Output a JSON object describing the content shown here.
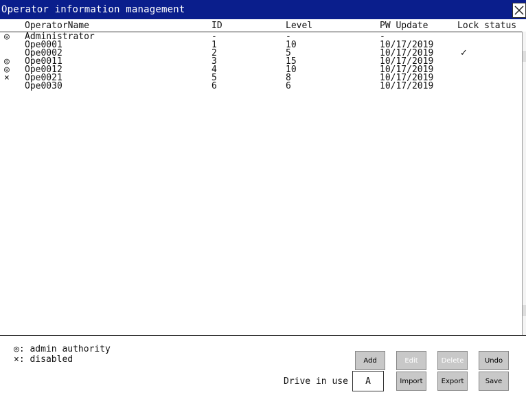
{
  "window": {
    "title": "Operator information management"
  },
  "columns": {
    "operator_name": "OperatorName",
    "id": "ID",
    "level": "Level",
    "pw_update": "PW Update",
    "lock_status": "Lock status"
  },
  "rows": [
    {
      "mark": "◎",
      "name": "Administrator",
      "id": "-",
      "level": "-",
      "pw_update": "-",
      "lock": ""
    },
    {
      "mark": "",
      "name": "Ope0001",
      "id": "1",
      "level": "10",
      "pw_update": "10/17/2019",
      "lock": ""
    },
    {
      "mark": "",
      "name": "Ope0002",
      "id": "2",
      "level": "5",
      "pw_update": "10/17/2019",
      "lock": "✓"
    },
    {
      "mark": "◎",
      "name": "Ope0011",
      "id": "3",
      "level": "15",
      "pw_update": "10/17/2019",
      "lock": ""
    },
    {
      "mark": "◎",
      "name": "Ope0012",
      "id": "4",
      "level": "10",
      "pw_update": "10/17/2019",
      "lock": ""
    },
    {
      "mark": "×",
      "name": "Ope0021",
      "id": "5",
      "level": "8",
      "pw_update": "10/17/2019",
      "lock": ""
    },
    {
      "mark": "",
      "name": "Ope0030",
      "id": "6",
      "level": "6",
      "pw_update": "10/17/2019",
      "lock": ""
    }
  ],
  "legend": {
    "admin": "◎: admin authority",
    "disabled": "×: disabled"
  },
  "buttons": {
    "add": "Add",
    "edit": "Edit",
    "delete": "Delete",
    "undo": "Undo",
    "import": "Import",
    "export": "Export",
    "save": "Save"
  },
  "drive": {
    "label": "Drive in use",
    "value": "A"
  },
  "colors": {
    "titlebar": "#0a1e8c",
    "button": "#c8c8c8",
    "button_disabled_text": "#ffffff"
  }
}
